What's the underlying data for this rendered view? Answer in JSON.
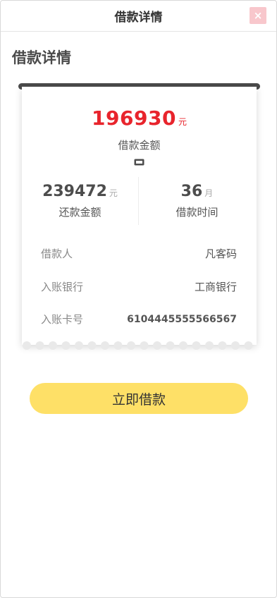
{
  "header": {
    "title": "借款详情",
    "close_icon": "close-icon",
    "close_color": "#f8c7cc"
  },
  "page": {
    "heading": "借款详情"
  },
  "loan": {
    "amount": "196930",
    "amount_unit": "元",
    "amount_label": "借款金额",
    "amount_icon": "ticket-icon",
    "repay_amount": "239472",
    "repay_unit": "元",
    "repay_label": "还款金额",
    "term": "36",
    "term_unit": "月",
    "term_label": "借款时间"
  },
  "details": [
    {
      "label": "借款人",
      "value": "凡客码"
    },
    {
      "label": "入账银行",
      "value": "工商银行"
    },
    {
      "label": "入账卡号",
      "value": "6104445555566567"
    }
  ],
  "action": {
    "label": "立即借款",
    "color": "#fee067"
  },
  "colors": {
    "accent_red": "#e8242c",
    "rail": "#4b4b4b"
  }
}
